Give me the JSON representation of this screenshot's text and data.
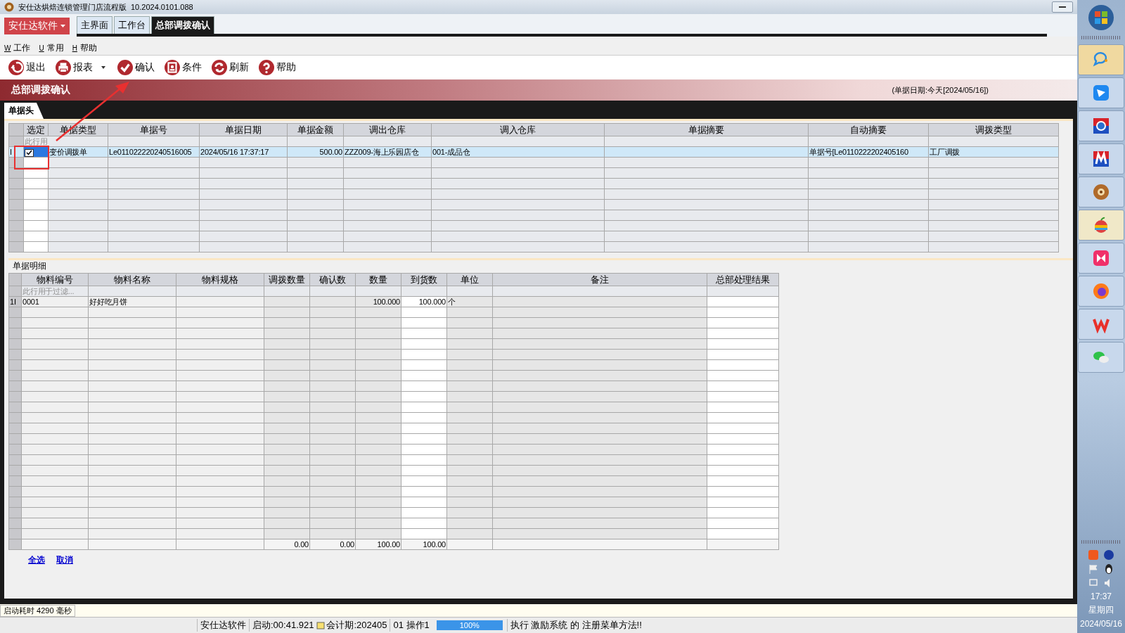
{
  "window": {
    "title": "安仕达烘焙连锁管理门店流程版",
    "version": "10.2024.0101.088"
  },
  "brand_menu": {
    "label": "安仕达软件"
  },
  "tabs": [
    {
      "label": "主界面",
      "selected": false
    },
    {
      "label": "工作台",
      "selected": false
    },
    {
      "label": "总部调拨确认",
      "selected": true
    }
  ],
  "menu": [
    {
      "key": "W",
      "label": "工作"
    },
    {
      "key": "U",
      "label": "常用"
    },
    {
      "key": "H",
      "label": "帮助"
    }
  ],
  "toolbar": [
    {
      "label": "退出",
      "has_dropdown": false
    },
    {
      "label": "报表",
      "has_dropdown": true
    },
    {
      "label": "确认",
      "has_dropdown": false
    },
    {
      "label": "条件",
      "has_dropdown": false
    },
    {
      "label": "刷新",
      "has_dropdown": false
    },
    {
      "label": "帮助",
      "has_dropdown": false
    }
  ],
  "page": {
    "title": "总部调拨确认",
    "date_note": "(单据日期:今天[2024/05/16])",
    "section_tab": "单据头",
    "detail_label": "单据明细"
  },
  "header_grid": {
    "filter_placeholder": "此行用",
    "columns": [
      "选定",
      "单据类型",
      "单据号",
      "单据日期",
      "单据金额",
      "调出仓库",
      "调入仓库",
      "单据摘要",
      "自动摘要",
      "调拨类型"
    ],
    "rows": [
      {
        "marker": "I",
        "selected": true,
        "checked": true,
        "type": "变价调拨单",
        "number": "Le011022220240516005",
        "date": "2024/05/16 17:37:17",
        "amount": "500.00",
        "source": "ZZZ009-海上乐园店仓",
        "target": "001-成品仓",
        "auto_summary": "单据号[Le0110222202405160",
        "transfer_type": "工厂调拨"
      }
    ]
  },
  "detail_grid": {
    "filter_placeholder": "此行用于过滤...",
    "columns": [
      "物料编号",
      "物料名称",
      "物料规格",
      "调拨数量",
      "确认数",
      "数量",
      "到货数",
      "单位",
      "备注",
      "总部处理结果"
    ],
    "rows": [
      {
        "row_number": "1",
        "marker": "I",
        "code": "0001",
        "name": "好好吃月饼",
        "count": "100.000",
        "arrived": "100.000",
        "unit": "个"
      }
    ],
    "totals": {
      "transfer_qty": "0.00",
      "confirmed": "0.00",
      "count": "100.00",
      "arrived": "100.00"
    }
  },
  "links": [
    "全选",
    "取消"
  ],
  "startup": "启动耗时 4290 毫秒",
  "status_bar": {
    "company": "安仕达软件",
    "uptime": "启动:00:41.921",
    "period": "会计期:202405",
    "operator": "01 操作1",
    "progress": {
      "level": 1,
      "reading": "100%"
    },
    "message": "执行 激励系统 的 注册菜单方法!!"
  },
  "annotations": [
    {
      "kind": "box"
    },
    {
      "kind": "arrow"
    }
  ],
  "tray": {
    "time": "17:37",
    "weekday": "星期四",
    "date": "2024/05/16"
  }
}
